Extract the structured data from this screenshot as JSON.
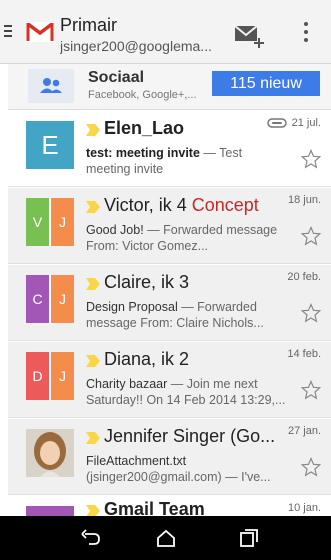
{
  "header": {
    "title": "Primair",
    "email": "jsinger200@googlema...",
    "menu_icon": "hamburger-icon",
    "logo_icon": "gmail-logo-icon",
    "compose_icon": "compose-mail-icon",
    "overflow_icon": "overflow-menu-icon"
  },
  "social": {
    "title": "Sociaal",
    "subtitle": "Facebook, Google+,...",
    "badge": "115 nieuw",
    "icon": "people-icon"
  },
  "mails": [
    {
      "sender": "Elen_Lao",
      "subject": "test: meeting invite",
      "snippet": " — Test meeting invite",
      "date": "21 jul.",
      "avatar_letter": "E",
      "avatar_color": "#42a5c6",
      "has_attachment": true,
      "unread": true
    },
    {
      "sender": "Victor, ik",
      "count": "4",
      "draft": "Concept",
      "subject": "Good Job!",
      "snippet": " — Forwarded message From: Victor Gomez...",
      "date": "18 jun.",
      "avatar_letters": [
        "V",
        "J"
      ],
      "avatar_colors": [
        "#78c051",
        "#f48c4c"
      ],
      "unread": false
    },
    {
      "sender": "Claire, ik",
      "count": "3",
      "subject": "Design Proposal",
      "snippet": " — Forwarded message From: Claire Nichols...",
      "date": "20 feb.",
      "avatar_letters": [
        "C",
        "J"
      ],
      "avatar_colors": [
        "#a256b5",
        "#f48c4c"
      ],
      "unread": false
    },
    {
      "sender": "Diana, ik",
      "count": "2",
      "subject": "Charity bazaar",
      "snippet": " — Join me next Saturday!! On 14 Feb 2014 13:29,...",
      "date": "14 feb.",
      "avatar_letters": [
        "D",
        "J"
      ],
      "avatar_colors": [
        "#ec5a5a",
        "#f48c4c"
      ],
      "unread": false
    },
    {
      "sender": "Jennifer Singer (Go...",
      "subject": "FileAttachment.txt",
      "snippet": " (jsinger200@gmail.com) — I've...",
      "date": "27 jan.",
      "avatar_photo": "person-photo",
      "unread": false
    },
    {
      "sender": "Gmail Team",
      "date": "10 jan.",
      "avatar_color": "#a256b5",
      "unread": true
    }
  ],
  "navbar": {
    "back_icon": "back-icon",
    "home_icon": "home-icon",
    "recents_icon": "recents-icon"
  },
  "colors": {
    "accent": "#3d7be7",
    "important_marker": "#f9d648",
    "draft": "#c62828"
  }
}
